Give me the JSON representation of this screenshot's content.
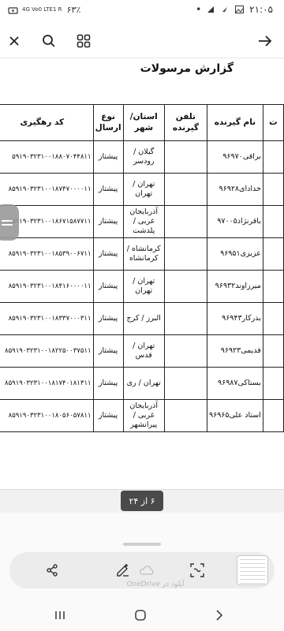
{
  "status_bar": {
    "time": "۲۱:۰۵",
    "battery": "۶۳٪",
    "network": "4G Vo0 LTE1 R"
  },
  "app_bar": {
    "icons": [
      "back-arrow-icon",
      "grid-icon",
      "search-icon",
      "close-icon"
    ]
  },
  "document": {
    "title": "گزارش مرسولات",
    "columns": [
      "",
      "نام گیرنده",
      "تلفن گیرنده",
      "استان/ شهر",
      "نوع ارسال",
      "کد رهگیری"
    ],
    "cut_header": "ت",
    "rows": [
      {
        "name": "براقی۹۶۹۷۰",
        "phone": "",
        "province": "گیلان / رودسر",
        "type": "پیشتاز",
        "tracking": "۵۹۱۹۰۳۲۳۱۰۰۱۸۸۰۷۰۴۴۸۱۱"
      },
      {
        "name": "خدادای۹۶۹۲۸",
        "phone": "",
        "province": "تهران / تهران",
        "type": "پیشتاز",
        "tracking": "۸۵۹۱۹۰۳۲۳۱۰۰۱۸۷۴۷۰۰۰۰۱۱"
      },
      {
        "name": "باقرنژاد۹۷۰۰۵",
        "phone": "",
        "province": "آذربایجان غربی / پلدشت",
        "type": "پیشتاز",
        "tracking": "۸۵۹۱۹۰۳۲۳۱۰۰۱۸۶۷۱۵۸۷۷۱۱"
      },
      {
        "name": "عزیزی۹۶۹۵۱",
        "phone": "",
        "province": "کرمانشاه / کرمانشاه",
        "type": "پیشتاز",
        "tracking": "۸۵۹۱۹۰۳۲۳۱۰۰۱۸۵۳۹۰۰۶۷۱۱"
      },
      {
        "name": "میرزاوند۹۶۹۳۲",
        "phone": "",
        "province": "تهران / تهران",
        "type": "پیشتاز",
        "tracking": "۸۵۹۱۹۰۳۲۳۱۰۰۱۸۴۱۶۰۰۰۰۱۱"
      },
      {
        "name": "بذرکار۹۶۹۴۳",
        "phone": "",
        "province": "البرز / کرج",
        "type": "پیشتاز",
        "tracking": "۸۵۹۱۹۰۳۲۳۱۰۰۱۸۳۳۷۰۰۰۳۱۱"
      },
      {
        "name": "قدیمی۹۶۹۲۳",
        "phone": "",
        "province": "تهران / قدس",
        "type": "پیشتاز",
        "tracking": "۸۵۹۱۹۰۳۲۳۱۰۰۱۸۲۲۵۰۰۳۷۵۱۱"
      },
      {
        "name": "بستاکی۹۶۹۸۷",
        "phone": "",
        "province": "تهران / ری",
        "type": "پیشتاز",
        "tracking": "۸۵۹۱۹۰۳۲۳۱۰۰۱۸۱۷۴۰۱۸۱۳۱۱"
      },
      {
        "name": "استاد علی۹۶۹۶۵",
        "phone": "",
        "province": "آذربایجان غربی / پیرانشهر",
        "type": "پیشتاز",
        "tracking": "۸۵۹۱۹۰۳۲۳۱۰۰۱۸۰۵۶۰۵۷۸۱۱"
      }
    ]
  },
  "page_indicator": "۶ از ۲۴",
  "bottom_toolbar": {
    "onedrive_label": "آپلود در OneDrive",
    "icons": [
      "share-icon",
      "sign-edit-icon",
      "scan-icon"
    ]
  },
  "nav_bar": {
    "icons": [
      "recent-apps-icon",
      "home-icon",
      "back-icon"
    ]
  }
}
